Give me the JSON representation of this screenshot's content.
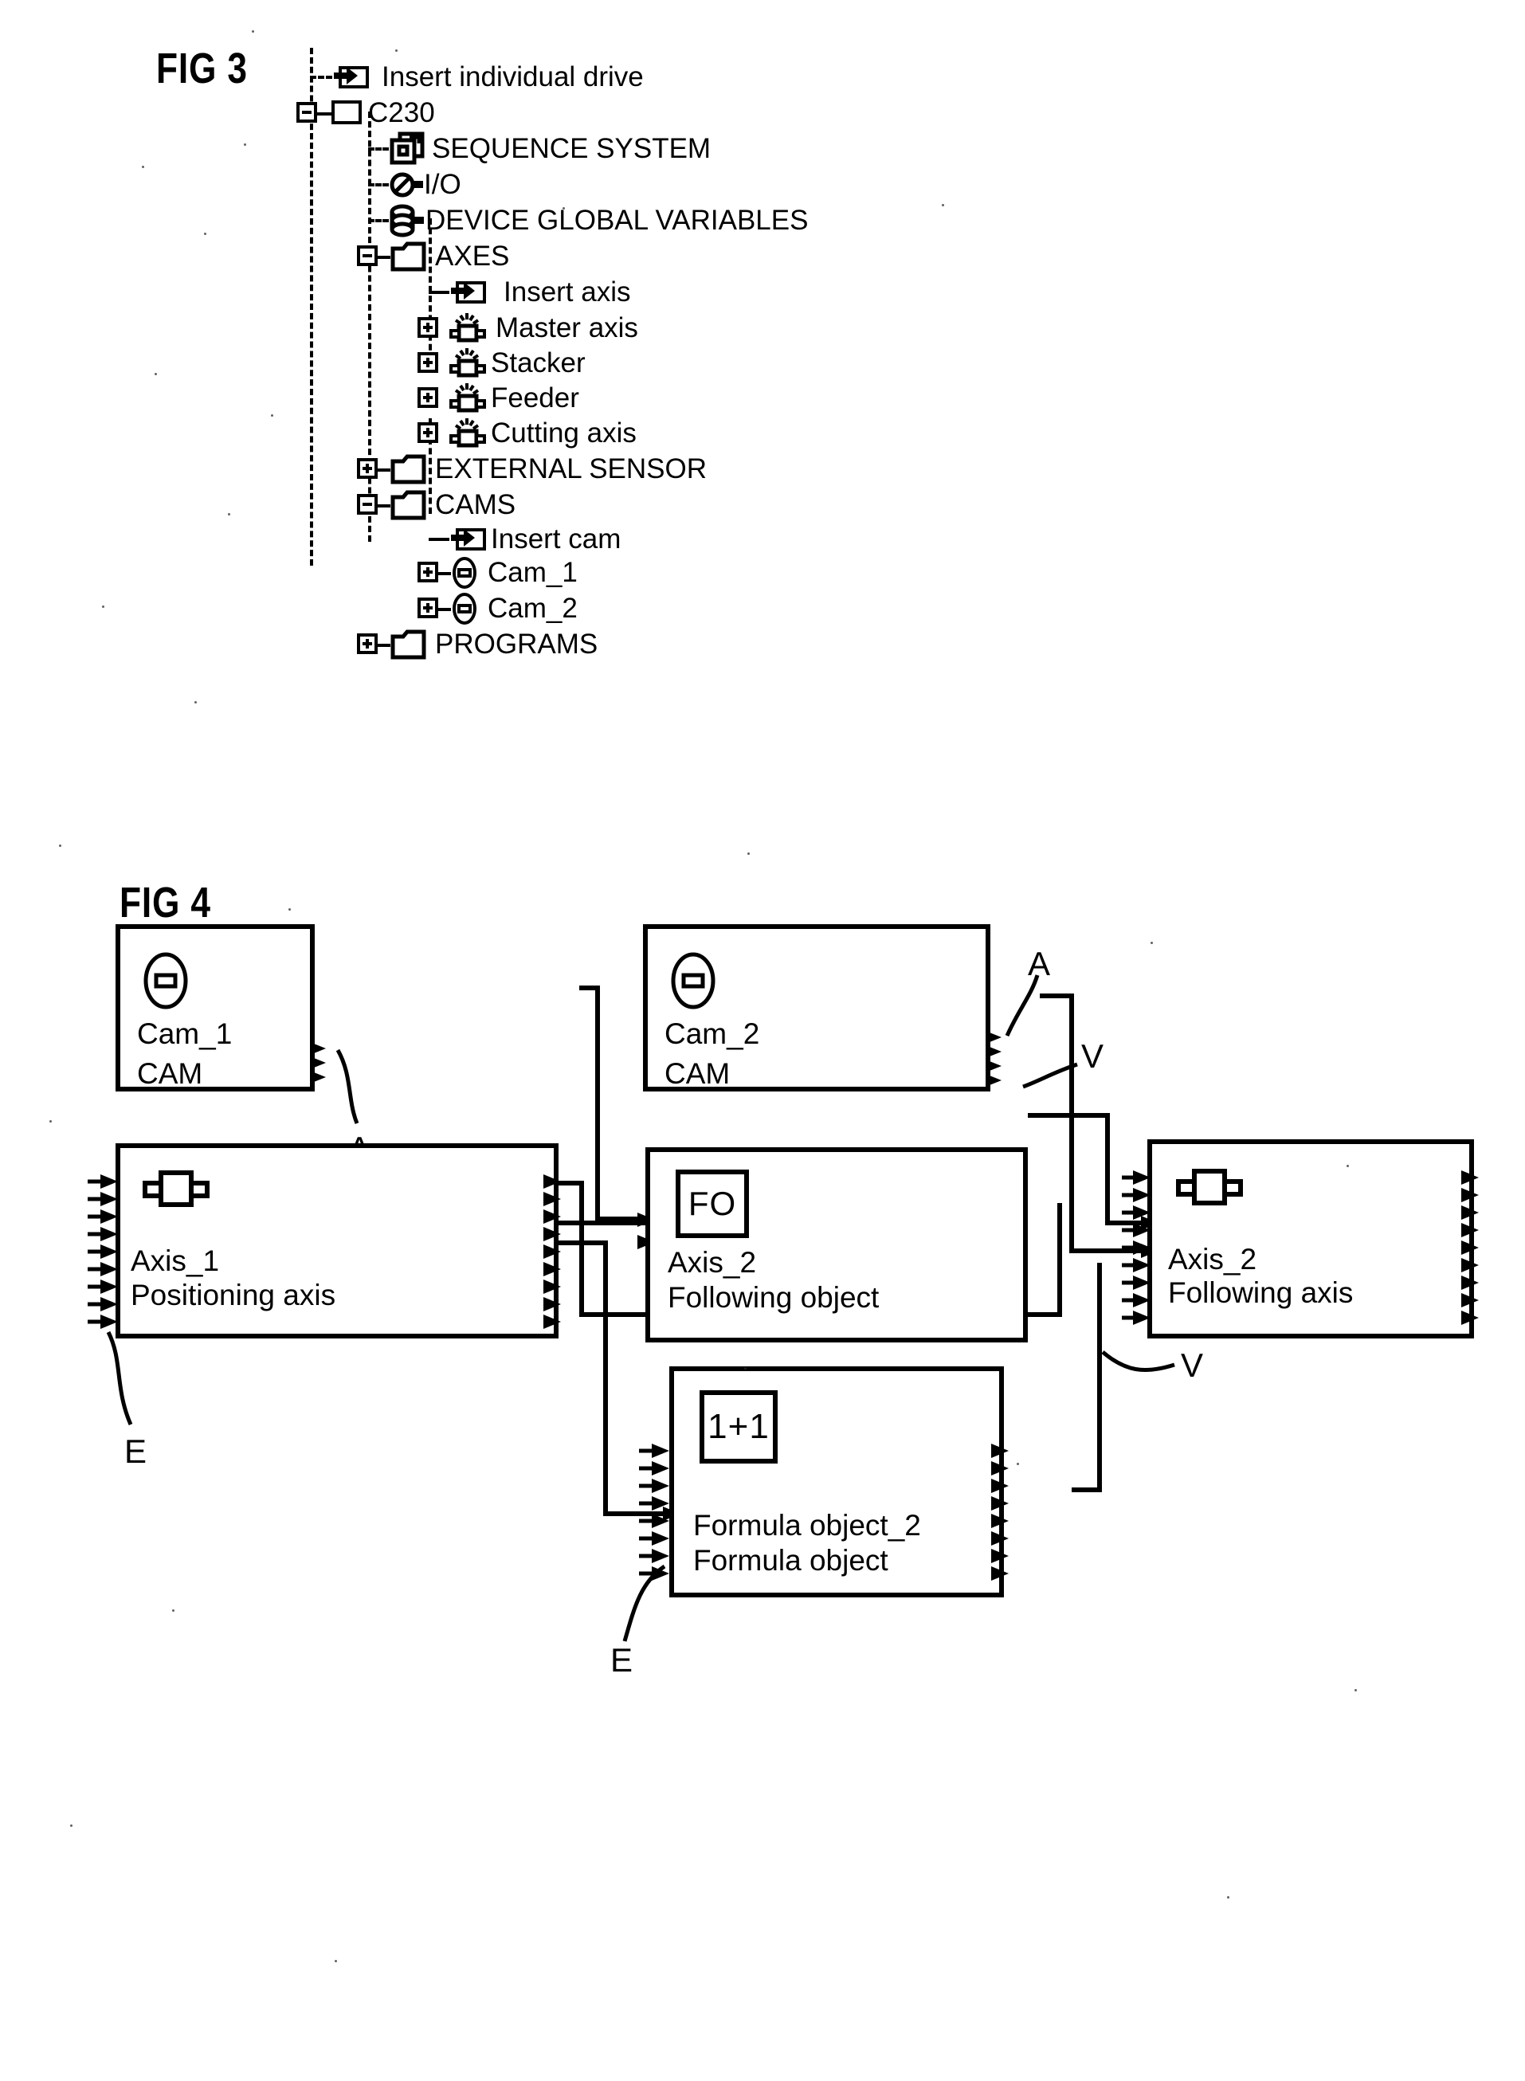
{
  "figures": {
    "fig3": {
      "caption": "FIG 3",
      "tree": [
        {
          "indent": 0,
          "expander": "none",
          "icon": "insert-icon",
          "label": "Insert individual drive"
        },
        {
          "indent": 0,
          "expander": "minus",
          "icon": "device-box-icon",
          "label": "C230"
        },
        {
          "indent": 1,
          "expander": "none",
          "icon": "sequence-icon",
          "label": "SEQUENCE SYSTEM"
        },
        {
          "indent": 1,
          "expander": "none",
          "icon": "io-icon",
          "label": "I/O"
        },
        {
          "indent": 1,
          "expander": "none",
          "icon": "database-icon",
          "label": "DEVICE GLOBAL VARIABLES"
        },
        {
          "indent": 1,
          "expander": "minus",
          "icon": "folder-icon",
          "label": "AXES"
        },
        {
          "indent": 2,
          "expander": "none",
          "icon": "insert-icon",
          "label": "Insert  axis"
        },
        {
          "indent": 2,
          "expander": "plus",
          "icon": "axis-motor-icon",
          "label": "Master  axis"
        },
        {
          "indent": 2,
          "expander": "plus",
          "icon": "axis-motor-icon",
          "label": "Stacker"
        },
        {
          "indent": 2,
          "expander": "plus",
          "icon": "axis-motor-icon",
          "label": "Feeder"
        },
        {
          "indent": 2,
          "expander": "plus",
          "icon": "axis-motor-icon",
          "label": "Cutting axis"
        },
        {
          "indent": 1,
          "expander": "plus",
          "icon": "folder-icon",
          "label": "EXTERNAL SENSOR"
        },
        {
          "indent": 1,
          "expander": "minus",
          "icon": "folder-icon",
          "label": "CAMS"
        },
        {
          "indent": 2,
          "expander": "none",
          "icon": "insert-icon",
          "label": "Insert cam"
        },
        {
          "indent": 2,
          "expander": "plus",
          "icon": "cam-icon",
          "label": "Cam_1"
        },
        {
          "indent": 2,
          "expander": "plus",
          "icon": "cam-icon",
          "label": "Cam_2"
        },
        {
          "indent": 1,
          "expander": "plus",
          "icon": "folder-icon",
          "label": "PROGRAMS"
        }
      ]
    },
    "fig4": {
      "caption": "FIG  4",
      "blocks": [
        {
          "id": "cam1",
          "icon": "cam-ellipse-icon",
          "icon_text": "",
          "name": "Cam_1",
          "type": "CAM"
        },
        {
          "id": "cam2",
          "icon": "cam-ellipse-icon",
          "icon_text": "",
          "name": "Cam_2",
          "type": "CAM"
        },
        {
          "id": "axis1",
          "icon": "axis-motor-icon",
          "icon_text": "",
          "name": "Axis_1",
          "type": "Positioning axis"
        },
        {
          "id": "axis2fo",
          "icon": "following-object-icon",
          "icon_text": "FO",
          "name": "Axis_2",
          "type": "Following object"
        },
        {
          "id": "axis2fa",
          "icon": "axis-motor-icon",
          "icon_text": "",
          "name": "Axis_2",
          "type": "Following axis"
        },
        {
          "id": "formula2",
          "icon": "formula-icon",
          "icon_text": "1+1",
          "name": "Formula object_2",
          "type": "Formula object"
        }
      ],
      "lead_labels": [
        {
          "id": "lead-a-cam1",
          "text": "A"
        },
        {
          "id": "lead-a-cam2",
          "text": "A"
        },
        {
          "id": "lead-v-cam2",
          "text": "V"
        },
        {
          "id": "lead-e-axis1",
          "text": "E"
        },
        {
          "id": "lead-v-axis2fa",
          "text": "V"
        },
        {
          "id": "lead-e-formula",
          "text": "E"
        }
      ]
    }
  },
  "colors": {
    "ink": "#000000",
    "paper": "#ffffff"
  }
}
